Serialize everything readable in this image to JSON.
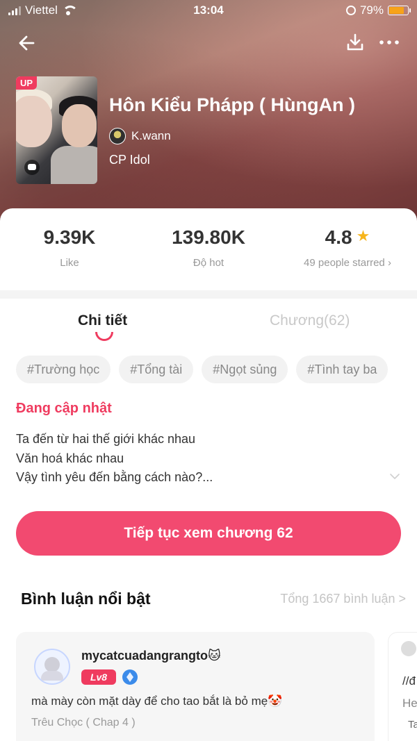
{
  "status_bar": {
    "carrier": "Viettel",
    "time": "13:04",
    "battery": "79%",
    "battery_level": 0.79
  },
  "nav": {
    "back_icon": "arrow-left-icon",
    "download_icon": "download-icon",
    "more_icon": "more-dots-icon"
  },
  "story": {
    "cover_badge": "UP",
    "title": "Hôn Kiểu Phápp ( HùngAn )",
    "author": "K.wann",
    "category": "CP Idol"
  },
  "stats": {
    "likes_value": "9.39K",
    "likes_label": "Like",
    "hot_value": "139.80K",
    "hot_label": "Độ hot",
    "rating_value": "4.8",
    "rating_label": "49 people starred",
    "rating_arrow": "›"
  },
  "tabs": [
    {
      "label": "Chi tiết",
      "active": true
    },
    {
      "label": "Chương(62)",
      "active": false
    }
  ],
  "tags": [
    "#Trường học",
    "#Tổng tài",
    "#Ngọt sủng",
    "#Tình tay ba"
  ],
  "status_text": "Đang cập nhật",
  "description": [
    "Ta đến từ hai thế giới khác nhau",
    "Văn hoá khác nhau",
    "Vậy tình yêu đến bằng cách nào?..."
  ],
  "cta_label": "Tiếp tục xem chương 62",
  "comments_section": {
    "title": "Bình luận nổi bật",
    "total_link": "Tổng 1667 bình luận >"
  },
  "comments": [
    {
      "user": "mycatcuadangrangto🐱",
      "level": "Lv8",
      "text": "mà mày còn mặt dày để cho tao bắt là bỏ mẹ🤡",
      "source": "Trêu Chọc ( Chap 4 )"
    },
    {
      "text_line1": "//đ",
      "text_line2": "He",
      "source": "Ta"
    }
  ],
  "colors": {
    "accent": "#f24a70",
    "brand_pink": "#ef3b5f",
    "star": "#f7b51c",
    "battery": "#f7a31a"
  }
}
